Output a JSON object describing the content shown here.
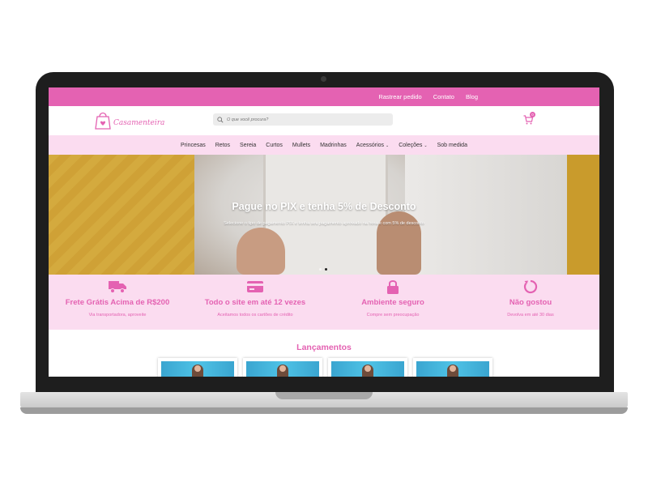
{
  "topbar": {
    "links": [
      "Rastrear pedido",
      "Contato",
      "Blog"
    ]
  },
  "header": {
    "logo_text": "Casamenteira",
    "search_placeholder": "O que você procura?",
    "cart_count": "0"
  },
  "nav": {
    "items": [
      "Princesas",
      "Retos",
      "Sereia",
      "Curtos",
      "Mullets",
      "Madrinhas",
      "Acessórios",
      "Coleções",
      "Sob medida"
    ]
  },
  "hero": {
    "title": "Pague no PIX e tenha 5% de Desconto",
    "subtitle": "Selecione o tipo de pagamento PIX e tenha seu pagamento aprovado na hora e com 5% de desconto"
  },
  "features": [
    {
      "icon": "truck-icon",
      "title": "Frete Grátis Acima de R$200",
      "subtitle": "Via transportadora, aproveite"
    },
    {
      "icon": "credit-card-icon",
      "title": "Todo o site em até 12 vezes",
      "subtitle": "Aceitamos todos os cartões de crédito"
    },
    {
      "icon": "lock-icon",
      "title": "Ambiente seguro",
      "subtitle": "Compre sem preocupação"
    },
    {
      "icon": "return-icon",
      "title": "Não gostou",
      "subtitle": "Devolva em até 30 dias"
    }
  ],
  "releases": {
    "title": "Lançamentos"
  },
  "colors": {
    "brand_pink": "#e462b2",
    "light_pink": "#fbdcf0"
  }
}
